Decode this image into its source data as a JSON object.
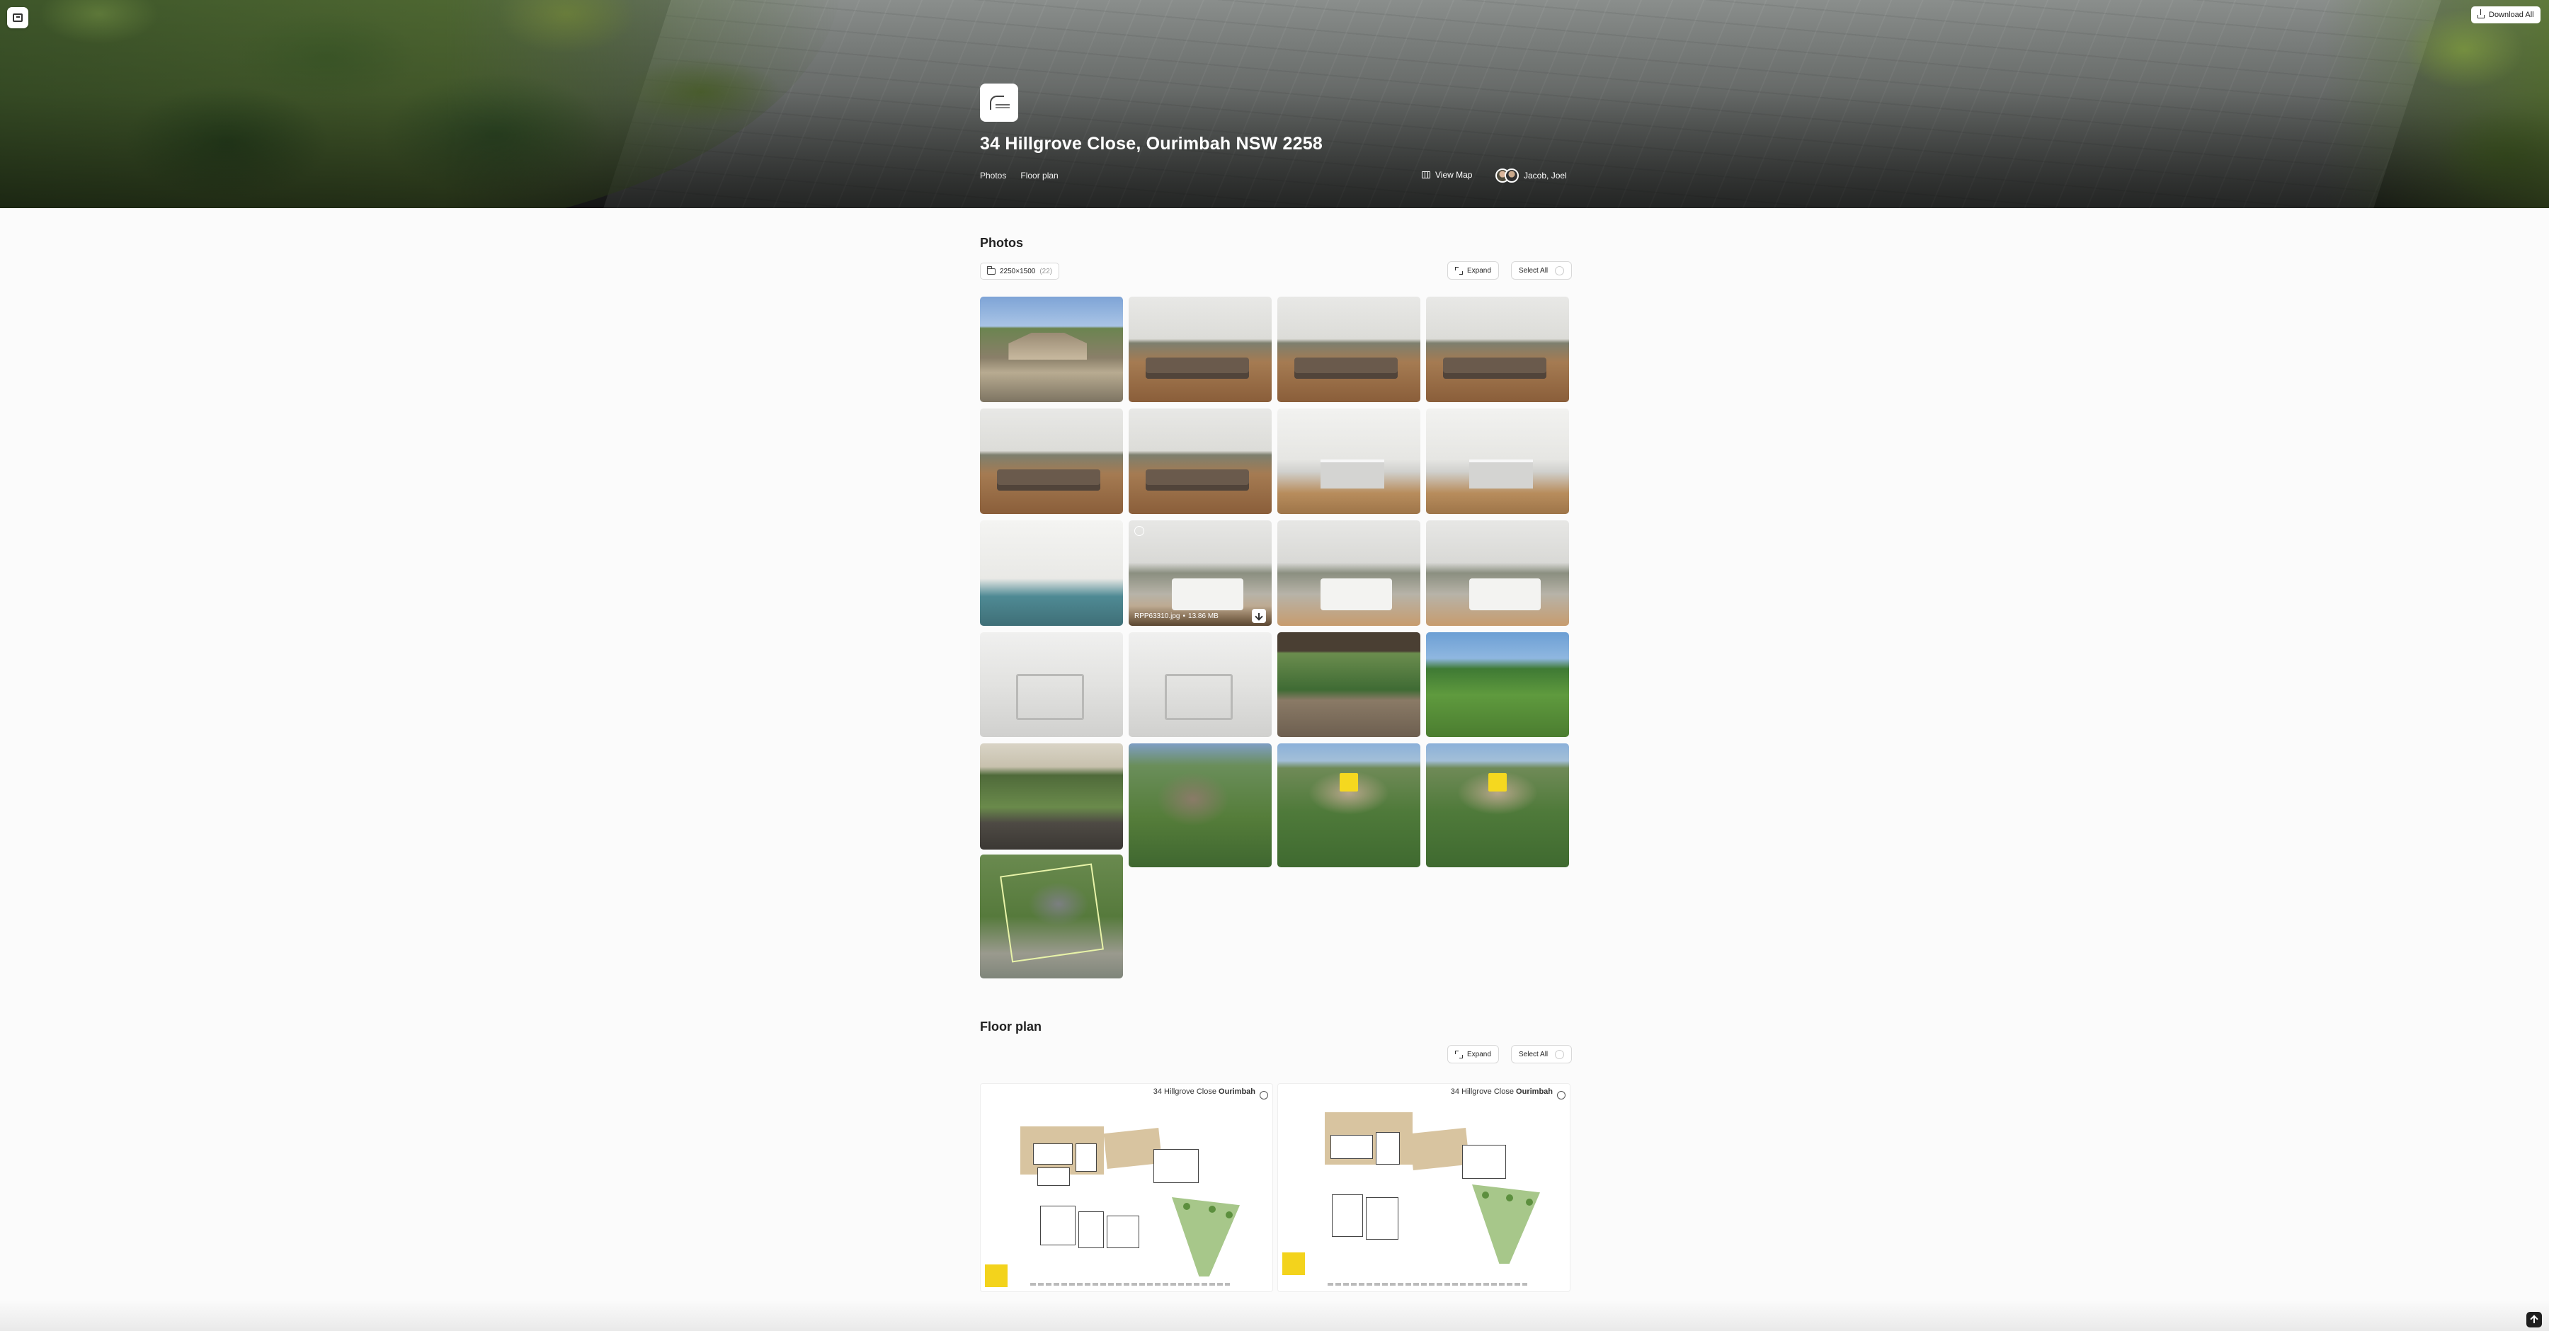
{
  "header": {
    "download_all_label": "Download All",
    "property_title": "34 Hillgrove Close, Ourimbah NSW 2258",
    "nav": [
      "Photos",
      "Floor plan"
    ],
    "view_map_label": "View Map",
    "agents_label": "Jacob, Joel"
  },
  "photos": {
    "title": "Photos",
    "resolution_label": "2250×1500",
    "resolution_count": "(22)",
    "expand_label": "Expand",
    "select_all_label": "Select All",
    "hovered_photo": {
      "filename": "RPP63310.jpg",
      "separator": "•",
      "size": "13.86 MB"
    },
    "tiles": [
      {
        "kind": "exterior",
        "name": "photo-house-front"
      },
      {
        "kind": "living",
        "name": "photo-living-1"
      },
      {
        "kind": "living",
        "name": "photo-living-2"
      },
      {
        "kind": "living",
        "name": "photo-living-3"
      },
      {
        "kind": "living",
        "name": "photo-open-plan-1"
      },
      {
        "kind": "living",
        "name": "photo-open-plan-2"
      },
      {
        "kind": "kitchen",
        "name": "photo-kitchen-1"
      },
      {
        "kind": "kitchen",
        "name": "photo-kitchen-2"
      },
      {
        "kind": "study",
        "name": "photo-study"
      },
      {
        "kind": "bed",
        "name": "photo-bedroom-1"
      },
      {
        "kind": "bed",
        "name": "photo-bedroom-2"
      },
      {
        "kind": "bed",
        "name": "photo-bedroom-3"
      },
      {
        "kind": "bath",
        "name": "photo-bathroom-1"
      },
      {
        "kind": "bath",
        "name": "photo-bathroom-2"
      },
      {
        "kind": "deck",
        "name": "photo-deck"
      },
      {
        "kind": "garden",
        "name": "photo-garden"
      },
      {
        "kind": "pergola",
        "name": "photo-pergola"
      },
      {
        "kind": "aerial house",
        "name": "photo-aerial-house"
      },
      {
        "kind": "aerial",
        "name": "photo-aerial-1"
      },
      {
        "kind": "aerial",
        "name": "photo-aerial-2"
      },
      {
        "kind": "site",
        "name": "photo-site-plan"
      }
    ]
  },
  "floor_plan": {
    "title": "Floor plan",
    "expand_label": "Expand",
    "select_all_label": "Select All",
    "plans": [
      {
        "heading_street": "34 Hillgrove Close",
        "heading_suburb": "Ourimbah"
      },
      {
        "heading_street": "34 Hillgrove Close",
        "heading_suburb": "Ourimbah"
      }
    ]
  },
  "colors": {
    "page_bg": "#fbfbfb",
    "brand_yellow": "#f3d31c",
    "text_dark": "#222222"
  },
  "icons": [
    "menu-icon",
    "download-icon",
    "map-icon",
    "folder-icon",
    "expand-icon",
    "arrow-up-icon"
  ]
}
